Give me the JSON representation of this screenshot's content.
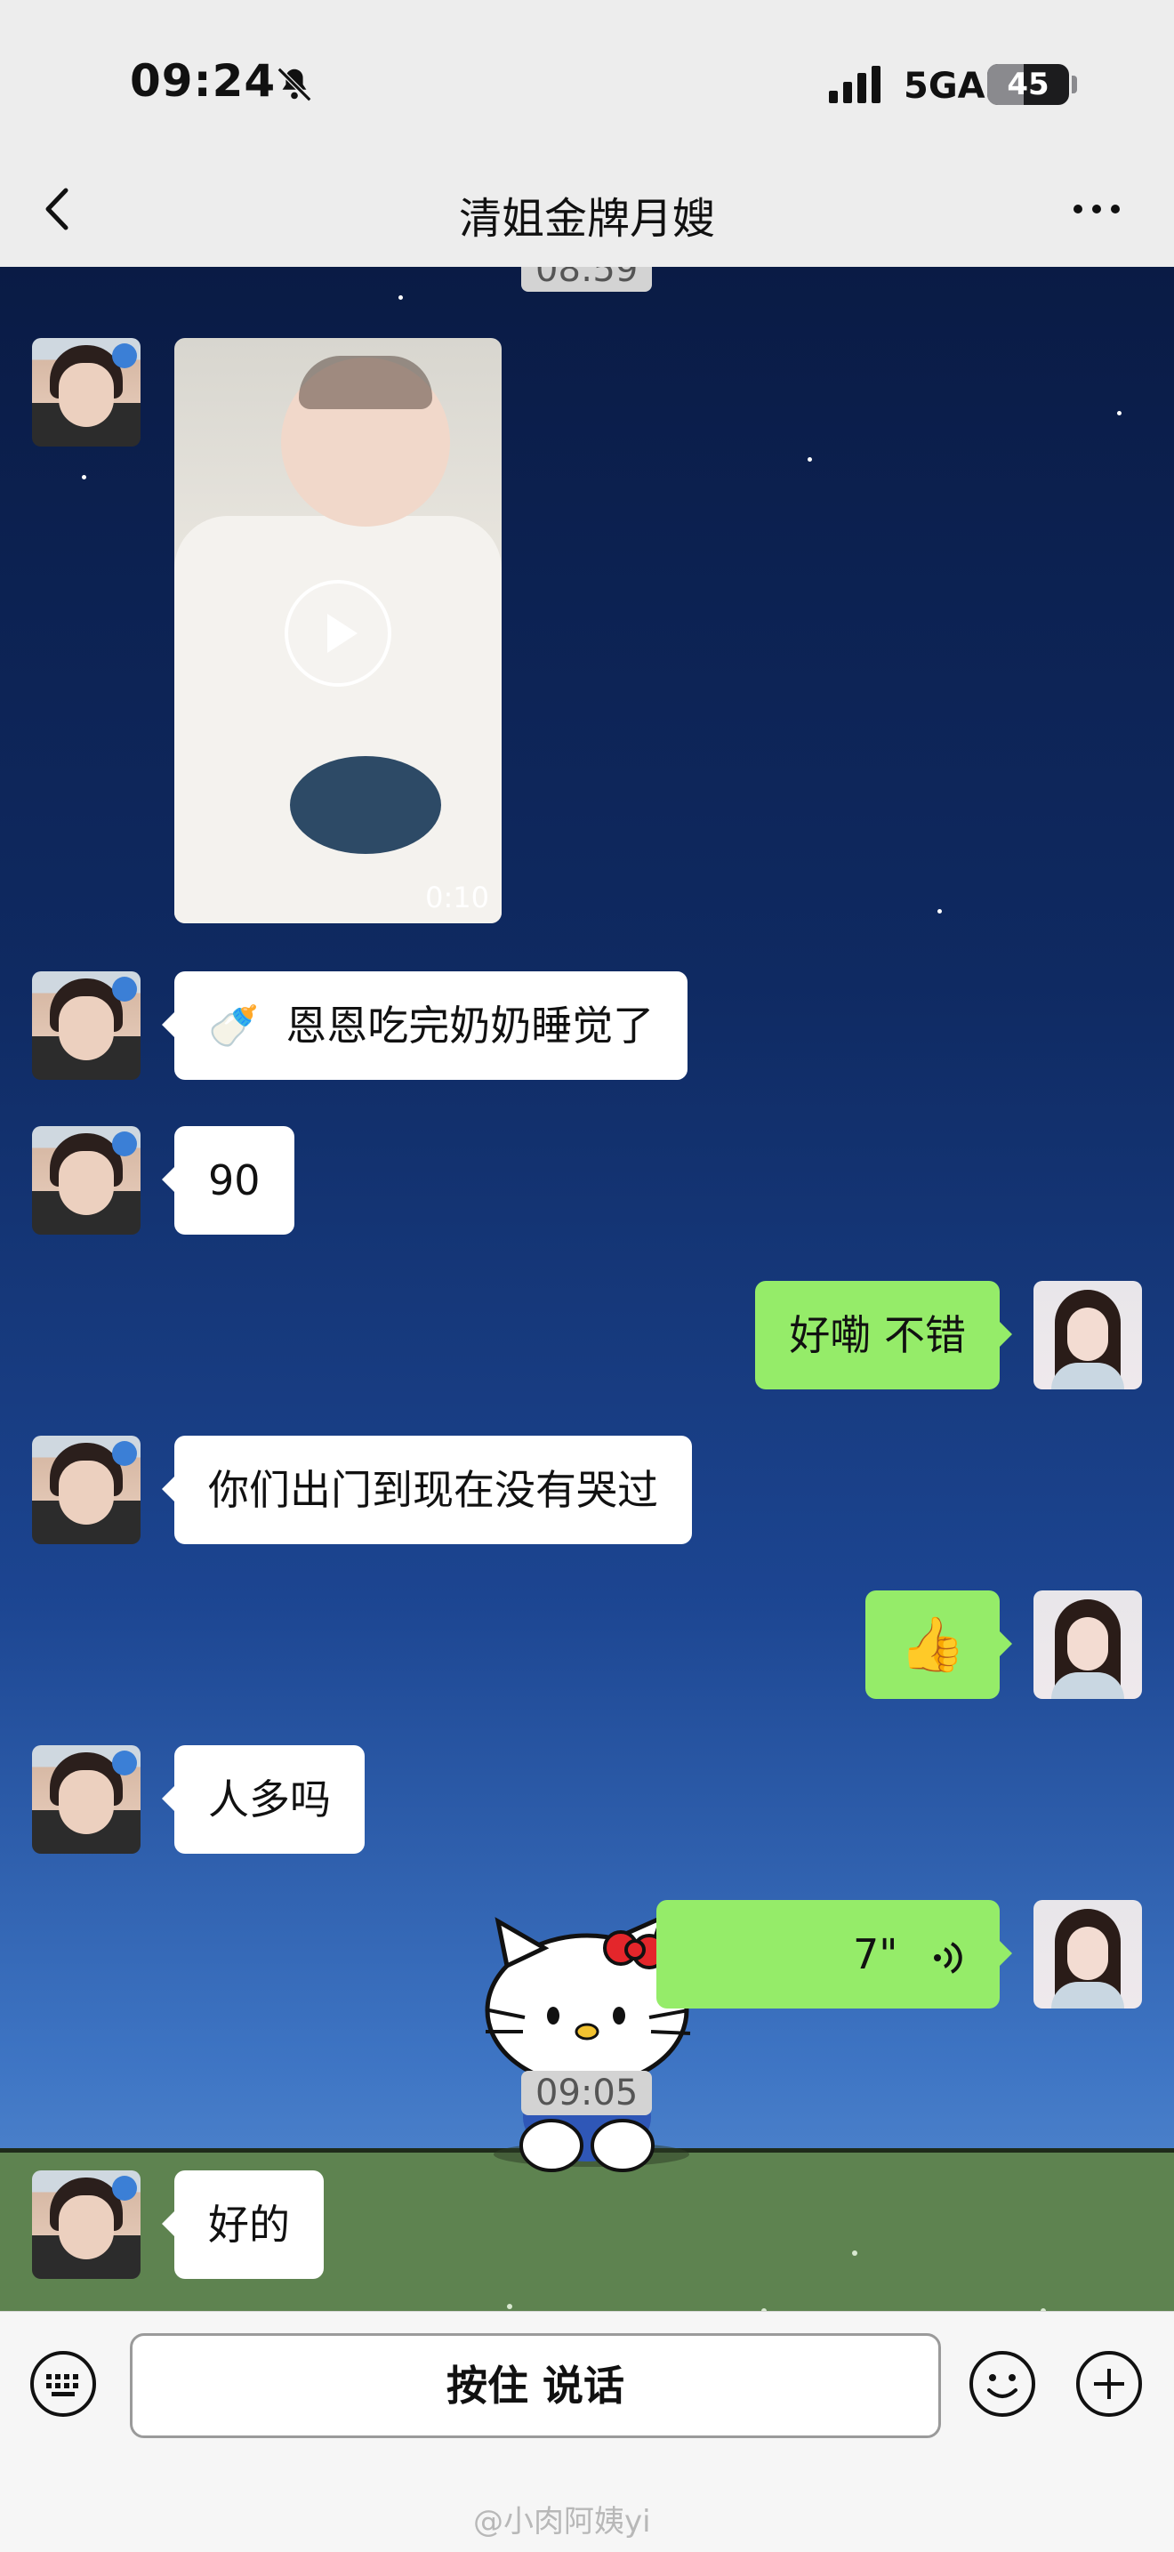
{
  "status_bar": {
    "time": "09:24",
    "network": "5GA",
    "battery": "45",
    "battery_level": 0.45
  },
  "header": {
    "title": "清姐金牌月嫂"
  },
  "timestamps": {
    "top": "08:59",
    "bottom": "09:05"
  },
  "video": {
    "duration": "0:10"
  },
  "messages": {
    "m1": "恩恩吃完奶奶睡觉了",
    "m1_prefix": "🍼",
    "m2": "90",
    "m3": "好嘞 不错",
    "m4": "你们出门到现在没有哭过",
    "m5": "👍",
    "m6": "人多吗",
    "m7_duration": "7\"",
    "m8": "好的"
  },
  "input_bar": {
    "hold_to_talk": "按住 说话"
  },
  "watermark": "@小肉阿姨yi",
  "colors": {
    "green_bubble": "#95ec69",
    "white_bubble": "#ffffff",
    "header_bg": "#ededed"
  }
}
